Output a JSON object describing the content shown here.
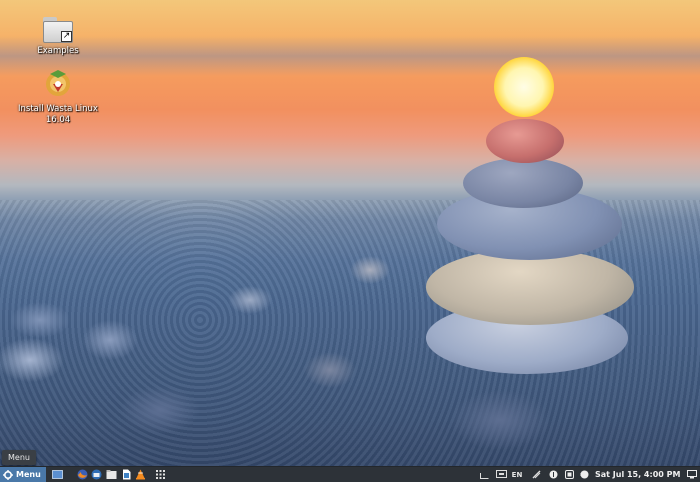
{
  "desktop": {
    "icons": [
      {
        "label": "Examples",
        "icon": "folder-link-icon"
      },
      {
        "label": "Install Wasta Linux 16.04",
        "icon": "installer-icon"
      }
    ]
  },
  "tooltip": {
    "text": "Menu"
  },
  "panel": {
    "menu_label": "Menu",
    "launchers": [
      "show-desktop-icon",
      "firefox-icon",
      "thunderbird-icon",
      "files-icon",
      "libreoffice-writer-icon",
      "vlc-icon",
      "app-grid-icon"
    ],
    "tray": [
      "keyboard-icon",
      "onscreen-keyboard-icon"
    ],
    "keyboard_layout": "EN",
    "tray_right": [
      "network-icon",
      "updates-icon",
      "wasta-icon",
      "notes-icon",
      "power-icon",
      "volume-icon"
    ],
    "clock": "Sat Jul 15,  4:00 PM",
    "colors": {
      "panel": "#2d3238",
      "menu_button": "#4a78a8"
    }
  }
}
